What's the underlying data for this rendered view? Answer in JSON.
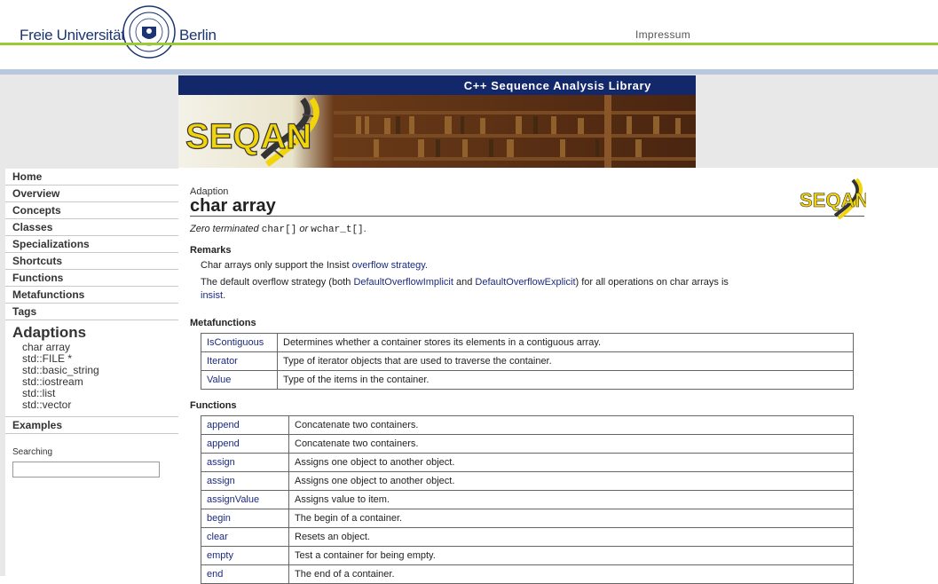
{
  "header": {
    "uni_left": "Freie Universität",
    "uni_right": "Berlin",
    "impressum": "Impressum"
  },
  "banner": {
    "title": "C++ Sequence Analysis Library",
    "logo_text": "SEQAN"
  },
  "nav": {
    "items": [
      "Home",
      "Overview",
      "Concepts",
      "Classes",
      "Specializations",
      "Shortcuts",
      "Functions",
      "Metafunctions",
      "Tags"
    ],
    "adaptions_heading": "Adaptions",
    "adaptions": [
      "char array",
      "std::FILE *",
      "std::basic_string",
      "std::iostream",
      "std::list",
      "std::vector"
    ],
    "examples": "Examples",
    "search_label": "Searching",
    "search_value": ""
  },
  "page": {
    "breadcrumb": "Adaption",
    "title": "char array",
    "summary": {
      "part1": "Zero terminated",
      "code1": "char[]",
      "part2": "or",
      "code2": "wchar_t[]",
      "part3": "."
    },
    "remarks_heading": "Remarks",
    "remarks": {
      "line1_text": "Char arrays only support the Insist",
      "line1_link": "overflow strategy",
      "line1_end": ".",
      "line2_text": "The default overflow strategy (both",
      "line2_link1": "DefaultOverflowImplicit",
      "line2_mid": "and",
      "line2_link2": "DefaultOverflowExplicit",
      "line2_end": ") for all operations on char arrays is",
      "line2_link3": "insist",
      "line2_dot": "."
    },
    "metafunctions_heading": "Metafunctions",
    "metafunctions": [
      {
        "name": "IsContiguous",
        "desc": "Determines whether a container stores its elements in a contiguous array."
      },
      {
        "name": "Iterator",
        "desc": "Type of iterator objects that are used to traverse the container."
      },
      {
        "name": "Value",
        "desc": "Type of the items in the container."
      }
    ],
    "functions_heading": "Functions",
    "functions": [
      {
        "name": "append",
        "desc": "Concatenate two containers."
      },
      {
        "name": "append",
        "desc": "Concatenate two containers."
      },
      {
        "name": "assign",
        "desc": "Assigns one object to another object."
      },
      {
        "name": "assign",
        "desc": "Assigns one object to another object."
      },
      {
        "name": "assignValue",
        "desc": "Assigns value to item."
      },
      {
        "name": "begin",
        "desc": "The begin of a container."
      },
      {
        "name": "clear",
        "desc": "Resets an object."
      },
      {
        "name": "empty",
        "desc": "Test a container for being empty."
      },
      {
        "name": "end",
        "desc": "The end of a container."
      }
    ]
  },
  "colors": {
    "fu_blue": "#1a3570",
    "green_line": "#99cc33",
    "banner_navy": "#12286a",
    "link": "#1a2a80",
    "logo_yellow": "#f2d40a"
  }
}
